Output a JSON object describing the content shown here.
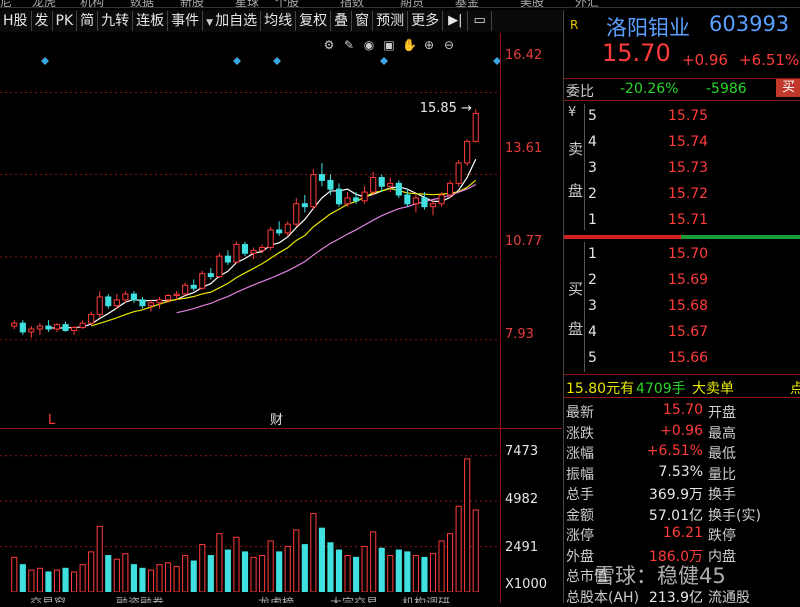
{
  "top_strip": [
    "尼",
    "龙虎",
    "机构",
    "数据",
    "新股",
    "星球",
    "个股",
    "指数",
    "期货",
    "基金",
    "美股",
    "外汇"
  ],
  "toolbar": {
    "items": [
      "H股",
      "发",
      "PK",
      "简",
      "九转",
      "连板",
      "事件",
      "加自选",
      "均线",
      "复权",
      "叠",
      "窗",
      "预测",
      "更多"
    ],
    "dropdown_items": [
      "加自选"
    ]
  },
  "chart": {
    "markers": {
      "low_label": "L",
      "fin_label": "财",
      "high_label": "15.85"
    },
    "price_axis": [
      "16.42",
      "13.61",
      "10.77",
      "7.93"
    ],
    "volume_axis": [
      "7473",
      "4982",
      "2491",
      "X1000"
    ]
  },
  "chart_data": {
    "type": "candlestick",
    "price_ylim": [
      6.0,
      17.5
    ],
    "volume_ylim": [
      0,
      8500
    ],
    "candles": [
      [
        8.4,
        8.6,
        8.3,
        8.5
      ],
      [
        8.5,
        8.6,
        8.1,
        8.2
      ],
      [
        8.2,
        8.4,
        8.0,
        8.3
      ],
      [
        8.3,
        8.5,
        8.1,
        8.4
      ],
      [
        8.4,
        8.6,
        8.2,
        8.3
      ],
      [
        8.3,
        8.5,
        8.2,
        8.45
      ],
      [
        8.45,
        8.55,
        8.2,
        8.25
      ],
      [
        8.25,
        8.4,
        8.1,
        8.35
      ],
      [
        8.35,
        8.6,
        8.3,
        8.5
      ],
      [
        8.5,
        8.9,
        8.45,
        8.8
      ],
      [
        8.8,
        9.6,
        8.7,
        9.4
      ],
      [
        9.4,
        9.5,
        9.0,
        9.1
      ],
      [
        9.1,
        9.5,
        9.0,
        9.3
      ],
      [
        9.3,
        9.6,
        9.2,
        9.5
      ],
      [
        9.5,
        9.6,
        9.2,
        9.3
      ],
      [
        9.3,
        9.4,
        9.0,
        9.1
      ],
      [
        9.1,
        9.3,
        8.9,
        9.2
      ],
      [
        9.2,
        9.4,
        9.0,
        9.3
      ],
      [
        9.3,
        9.5,
        9.2,
        9.45
      ],
      [
        9.45,
        9.6,
        9.3,
        9.5
      ],
      [
        9.5,
        9.9,
        9.45,
        9.8
      ],
      [
        9.8,
        10.0,
        9.6,
        9.7
      ],
      [
        9.7,
        10.3,
        9.65,
        10.2
      ],
      [
        10.2,
        10.4,
        10.0,
        10.1
      ],
      [
        10.1,
        10.9,
        10.05,
        10.8
      ],
      [
        10.8,
        11.0,
        10.5,
        10.6
      ],
      [
        10.6,
        11.3,
        10.55,
        11.2
      ],
      [
        11.2,
        11.3,
        10.8,
        10.9
      ],
      [
        10.9,
        11.1,
        10.7,
        11.0
      ],
      [
        11.0,
        11.2,
        10.9,
        11.1
      ],
      [
        11.1,
        11.8,
        11.0,
        11.7
      ],
      [
        11.7,
        12.0,
        11.5,
        11.6
      ],
      [
        11.6,
        12.0,
        11.5,
        11.9
      ],
      [
        11.9,
        12.8,
        11.8,
        12.6
      ],
      [
        12.6,
        12.9,
        12.3,
        12.5
      ],
      [
        12.5,
        13.8,
        12.4,
        13.6
      ],
      [
        13.6,
        14.0,
        13.2,
        13.4
      ],
      [
        13.4,
        13.6,
        12.9,
        13.1
      ],
      [
        13.1,
        13.3,
        12.5,
        12.6
      ],
      [
        12.6,
        13.0,
        12.5,
        12.8
      ],
      [
        12.8,
        13.0,
        12.6,
        12.7
      ],
      [
        12.7,
        13.2,
        12.6,
        13.0
      ],
      [
        13.0,
        13.7,
        12.9,
        13.5
      ],
      [
        13.5,
        13.6,
        13.0,
        13.2
      ],
      [
        13.2,
        13.5,
        13.0,
        13.3
      ],
      [
        13.3,
        13.4,
        12.8,
        12.9
      ],
      [
        12.9,
        13.1,
        12.5,
        12.6
      ],
      [
        12.6,
        12.9,
        12.3,
        12.8
      ],
      [
        12.8,
        13.0,
        12.4,
        12.5
      ],
      [
        12.5,
        12.7,
        12.2,
        12.6
      ],
      [
        12.6,
        13.0,
        12.5,
        12.9
      ],
      [
        12.9,
        13.4,
        12.8,
        13.3
      ],
      [
        13.3,
        14.1,
        13.2,
        14.0
      ],
      [
        14.0,
        14.8,
        13.9,
        14.74
      ],
      [
        14.74,
        15.85,
        14.7,
        15.7
      ]
    ],
    "volume": [
      1900,
      1500,
      1200,
      1300,
      1100,
      1200,
      1300,
      1100,
      1500,
      2200,
      3600,
      2000,
      1800,
      2100,
      1500,
      1300,
      1200,
      1500,
      1600,
      1400,
      2000,
      1700,
      2600,
      2000,
      3200,
      2300,
      3000,
      2200,
      1900,
      2000,
      2800,
      2200,
      2500,
      3400,
      2600,
      4300,
      3500,
      2700,
      2300,
      2000,
      1900,
      2500,
      3300,
      2400,
      2000,
      2300,
      2200,
      2000,
      1900,
      2100,
      2800,
      3200,
      4700,
      7300,
      4500
    ]
  },
  "quote": {
    "tag": "R",
    "name": "洛阳钼业",
    "code": "603993",
    "price": "15.70",
    "change": "+0.96",
    "pct": "+6.51%",
    "weibi_label": "委比",
    "weibi_pct": "-20.26%",
    "weicha": "-5986",
    "weibi_tail": "买",
    "sell_side_label": [
      "卖",
      "盘"
    ],
    "buy_side_label": [
      "买",
      "盘"
    ],
    "asks": [
      {
        "n": "5",
        "price": "15.75"
      },
      {
        "n": "4",
        "price": "15.74"
      },
      {
        "n": "3",
        "price": "15.73"
      },
      {
        "n": "2",
        "price": "15.72"
      },
      {
        "n": "1",
        "price": "15.71"
      }
    ],
    "bids": [
      {
        "n": "1",
        "price": "15.70"
      },
      {
        "n": "2",
        "price": "15.69"
      },
      {
        "n": "3",
        "price": "15.68"
      },
      {
        "n": "4",
        "price": "15.67"
      },
      {
        "n": "5",
        "price": "15.66"
      }
    ],
    "notice": {
      "a": "15.80元有",
      "b": "4709手",
      "c": "大卖单",
      "d": "点"
    },
    "stats": [
      {
        "l": "最新",
        "v": "15.70",
        "c": "red",
        "l2": "开盘"
      },
      {
        "l": "涨跌",
        "v": "+0.96",
        "c": "red",
        "l2": "最高"
      },
      {
        "l": "涨幅",
        "v": "+6.51%",
        "c": "red",
        "l2": "最低"
      },
      {
        "l": "振幅",
        "v": "7.53%",
        "c": "wht",
        "l2": "量比"
      },
      {
        "l": "总手",
        "v": "369.9万",
        "c": "wht",
        "l2": "换手"
      },
      {
        "l": "金额",
        "v": "57.01亿",
        "c": "wht",
        "l2": "换手(实)"
      },
      {
        "l": "涨停",
        "v": "16.21",
        "c": "red",
        "l2": "跌停"
      },
      {
        "l": "外盘",
        "v": "186.0万",
        "c": "red",
        "l2": "内盘"
      },
      {
        "l": "总市值",
        "v": "",
        "c": "wht",
        "l2": ""
      },
      {
        "l": "总股本(AH)",
        "v": "213.9亿",
        "c": "wht",
        "l2": "流通股"
      }
    ],
    "watermark": "雪球：稳健45"
  },
  "bottom_tabs": [
    "交易窗",
    "融资融券",
    "龙虎榜",
    "大宗交易",
    "机构调研"
  ],
  "colors": {
    "up": "#ff3b3b",
    "down": "#40e0e0",
    "ma5": "#ffffff",
    "ma10": "#e6e600",
    "ma20": "#e080e0",
    "grid": "#8a1515"
  }
}
